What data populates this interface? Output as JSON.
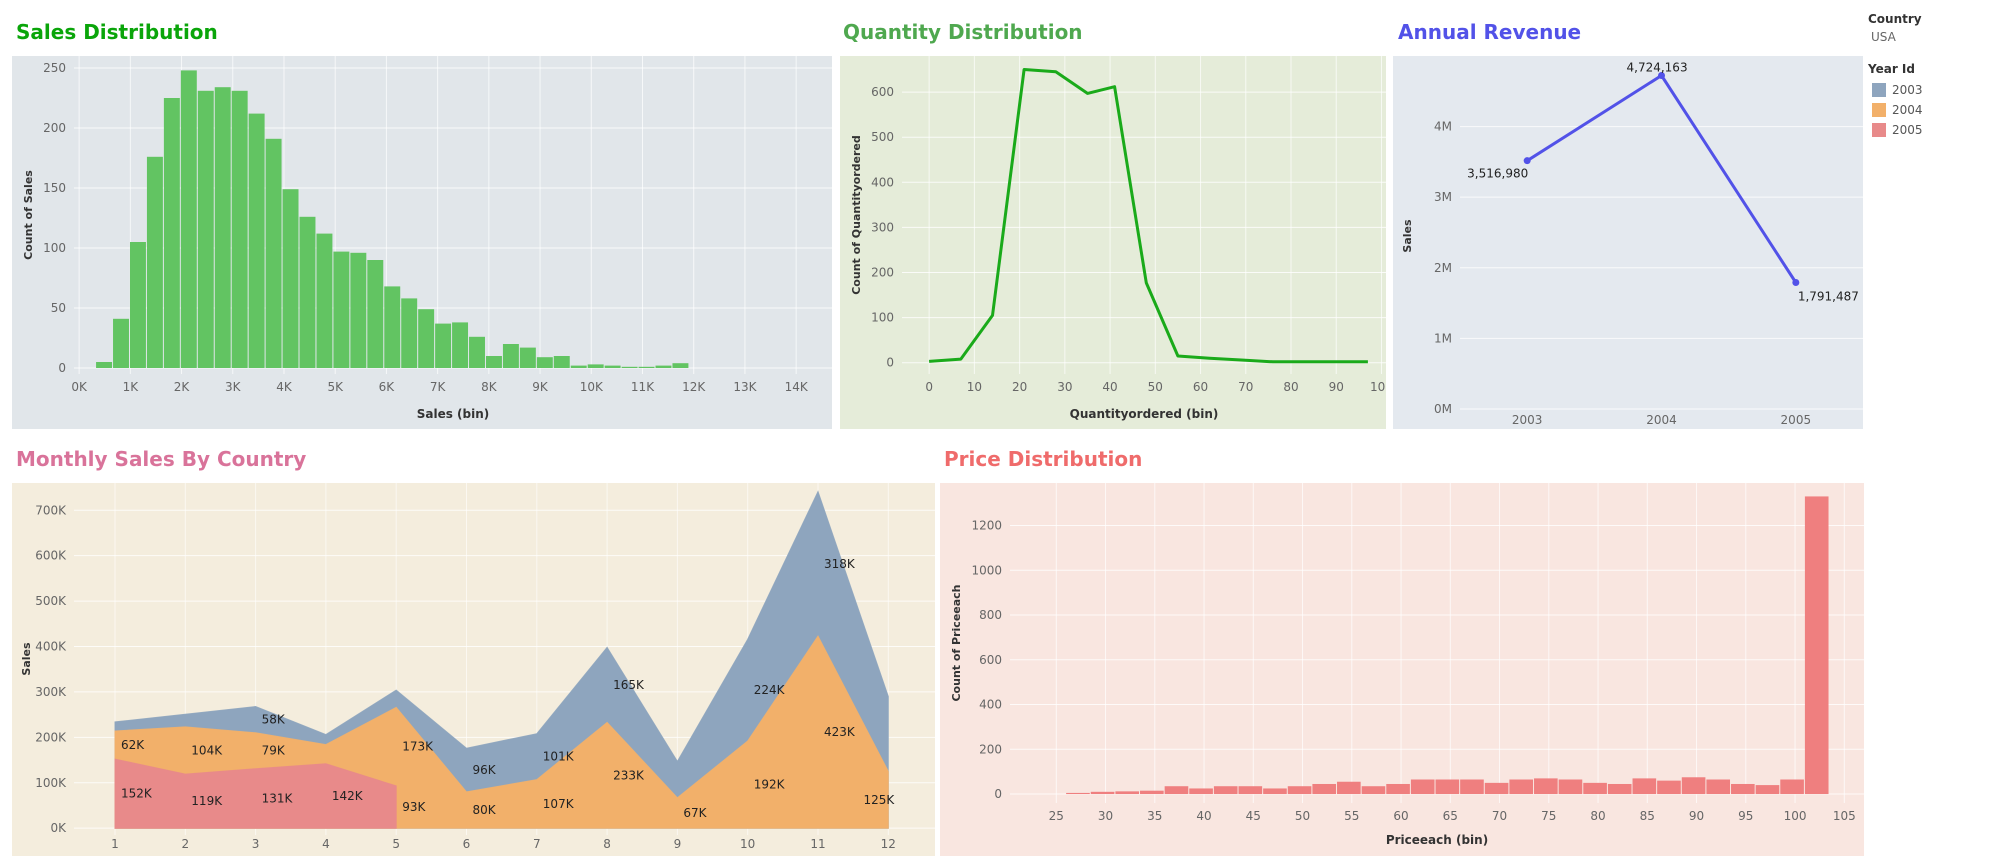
{
  "titles": {
    "sales": "Sales Distribution",
    "quantity": "Quantity Distribution",
    "annual": "Annual Revenue",
    "monthly": "Monthly Sales By Country",
    "price": "Price Distribution"
  },
  "legend": {
    "country_header": "Country",
    "country_value": "USA",
    "year_header": "Year Id",
    "items": [
      {
        "label": "2003",
        "color": "#8ea5be"
      },
      {
        "label": "2004",
        "color": "#f2b06a"
      },
      {
        "label": "2005",
        "color": "#e88a8a"
      }
    ]
  },
  "chart_data": [
    {
      "id": "sales",
      "type": "bar",
      "title": "Sales Distribution",
      "xlabel": "Sales (bin)",
      "ylabel": "Count of Sales",
      "bar_color": "#62c462",
      "bg": "#e1e6ea",
      "bin_width": 331,
      "bin_starts": [
        331,
        662,
        993,
        1324,
        1655,
        1986,
        2317,
        2648,
        2979,
        3310,
        3641,
        3972,
        4303,
        4634,
        4965,
        5296,
        5627,
        5958,
        6289,
        6620,
        6951,
        7282,
        7613,
        7944,
        8275,
        8606,
        8937,
        9268,
        9599,
        9930,
        10261,
        10592,
        10923,
        11254,
        11585
      ],
      "values": [
        5,
        41,
        105,
        176,
        225,
        248,
        231,
        234,
        231,
        212,
        191,
        149,
        126,
        112,
        97,
        96,
        90,
        68,
        58,
        49,
        37,
        38,
        26,
        10,
        20,
        17,
        9,
        10,
        2,
        3,
        2,
        1,
        1,
        2,
        4
      ],
      "xlim": [
        -100,
        14700
      ],
      "xticks": [
        0,
        1000,
        2000,
        3000,
        4000,
        5000,
        6000,
        7000,
        8000,
        9000,
        10000,
        11000,
        12000,
        13000,
        14000
      ],
      "xtick_labels": [
        "0K",
        "1K",
        "2K",
        "3K",
        "4K",
        "5K",
        "6K",
        "7K",
        "8K",
        "9K",
        "10K",
        "11K",
        "12K",
        "13K",
        "14K"
      ],
      "ylim": [
        -5,
        260
      ],
      "yticks": [
        0,
        50,
        100,
        150,
        200,
        250
      ],
      "ytick_labels": [
        "0",
        "50",
        "100",
        "150",
        "200",
        "250"
      ]
    },
    {
      "id": "quantity",
      "type": "line",
      "title": "Quantity Distribution",
      "xlabel": "Quantityordered (bin)",
      "ylabel": "Count of Quantityordered",
      "line_color": "#1aaa1a",
      "bg": "#e5ecd9",
      "x": [
        0,
        7,
        14,
        21,
        28,
        35,
        41,
        48,
        55,
        62,
        69,
        76,
        83,
        90,
        97
      ],
      "values": [
        3,
        8,
        105,
        650,
        645,
        597,
        612,
        177,
        15,
        10,
        6,
        2,
        2,
        2,
        2
      ],
      "xlim": [
        -6,
        101
      ],
      "xticks": [
        0,
        10,
        20,
        30,
        40,
        50,
        60,
        70,
        80,
        90,
        100
      ],
      "xtick_labels": [
        "0",
        "10",
        "20",
        "30",
        "40",
        "50",
        "60",
        "70",
        "80",
        "90",
        "100"
      ],
      "ylim": [
        -25,
        680
      ],
      "yticks": [
        0,
        100,
        200,
        300,
        400,
        500,
        600
      ],
      "ytick_labels": [
        "0",
        "100",
        "200",
        "300",
        "400",
        "500",
        "600"
      ]
    },
    {
      "id": "annual",
      "type": "line",
      "title": "Annual Revenue",
      "xlabel": "",
      "ylabel": "Sales",
      "line_color": "#5252e8",
      "bg": "#e4e9ef",
      "categories": [
        "2003",
        "2004",
        "2005"
      ],
      "values": [
        3516980,
        4724163,
        1791487
      ],
      "labels": [
        "3,516,980",
        "4,724,163",
        "1,791,487"
      ],
      "ylim": [
        -100000,
        5000000
      ],
      "yticks": [
        0,
        1000000,
        2000000,
        3000000,
        4000000
      ],
      "ytick_labels": [
        "0M",
        "1M",
        "2M",
        "3M",
        "4M"
      ]
    },
    {
      "id": "monthly",
      "type": "area",
      "title": "Monthly Sales By Country",
      "xlabel": "",
      "ylabel": "Sales",
      "bg": "#f4eddd",
      "categories": [
        "1",
        "2",
        "3",
        "4",
        "5",
        "6",
        "7",
        "8",
        "9",
        "10",
        "11",
        "12"
      ],
      "series": [
        {
          "name": "2005",
          "color": "#e88a8a",
          "values": [
            152000,
            119000,
            131000,
            142000,
            93000,
            null,
            null,
            null,
            null,
            null,
            null,
            null
          ],
          "labels": [
            "152K",
            "119K",
            "131K",
            "142K",
            "93K",
            "",
            "",
            "",
            "",
            "",
            "",
            ""
          ]
        },
        {
          "name": "2004",
          "color": "#f2b06a",
          "values": [
            62000,
            104000,
            79000,
            42000,
            173000,
            80000,
            107000,
            233000,
            67000,
            192000,
            423000,
            125000
          ],
          "labels": [
            "62K",
            "104K",
            "79K",
            "",
            "173K",
            "80K",
            "107K",
            "233K",
            "67K",
            "192K",
            "423K",
            "125K"
          ]
        },
        {
          "name": "2003",
          "color": "#8ea5be",
          "values": [
            20000,
            28000,
            58000,
            22000,
            38000,
            96000,
            101000,
            165000,
            80000,
            224000,
            318000,
            165000
          ],
          "labels": [
            "",
            "",
            "58K",
            "",
            "",
            "96K",
            "101K",
            "165K",
            "",
            "224K",
            "318K",
            ""
          ]
        }
      ],
      "ylim": [
        -15000,
        760000
      ],
      "yticks": [
        0,
        100000,
        200000,
        300000,
        400000,
        500000,
        600000,
        700000
      ],
      "ytick_labels": [
        "0K",
        "100K",
        "200K",
        "300K",
        "400K",
        "500K",
        "600K",
        "700K"
      ]
    },
    {
      "id": "price",
      "type": "bar",
      "title": "Price Distribution",
      "xlabel": "Priceeach (bin)",
      "ylabel": "Count of Priceeach",
      "bar_color": "#ef7f7f",
      "bg": "#f9e6e0",
      "bin_width": 2.5,
      "bin_starts": [
        26,
        28.5,
        31,
        33.5,
        36,
        38.5,
        41,
        43.5,
        46,
        48.5,
        51,
        53.5,
        56,
        58.5,
        61,
        63.5,
        66,
        68.5,
        71,
        73.5,
        76,
        78.5,
        81,
        83.5,
        86,
        88.5,
        91,
        93.5,
        96,
        98.5,
        101
      ],
      "values": [
        5,
        10,
        12,
        15,
        35,
        25,
        35,
        35,
        25,
        35,
        45,
        55,
        35,
        45,
        65,
        65,
        65,
        50,
        65,
        70,
        65,
        50,
        45,
        70,
        60,
        75,
        65,
        45,
        40,
        65,
        1330
      ],
      "xlim": [
        20.3,
        107
      ],
      "xticks": [
        25,
        30,
        35,
        40,
        45,
        50,
        55,
        60,
        65,
        70,
        75,
        80,
        85,
        90,
        95,
        100,
        105
      ],
      "xtick_labels": [
        "25",
        "30",
        "35",
        "40",
        "45",
        "50",
        "55",
        "60",
        "65",
        "70",
        "75",
        "80",
        "85",
        "90",
        "95",
        "100",
        "105"
      ],
      "ylim": [
        -40,
        1390
      ],
      "yticks": [
        0,
        200,
        400,
        600,
        800,
        1000,
        1200
      ],
      "ytick_labels": [
        "0",
        "200",
        "400",
        "600",
        "800",
        "1000",
        "1200"
      ]
    }
  ]
}
